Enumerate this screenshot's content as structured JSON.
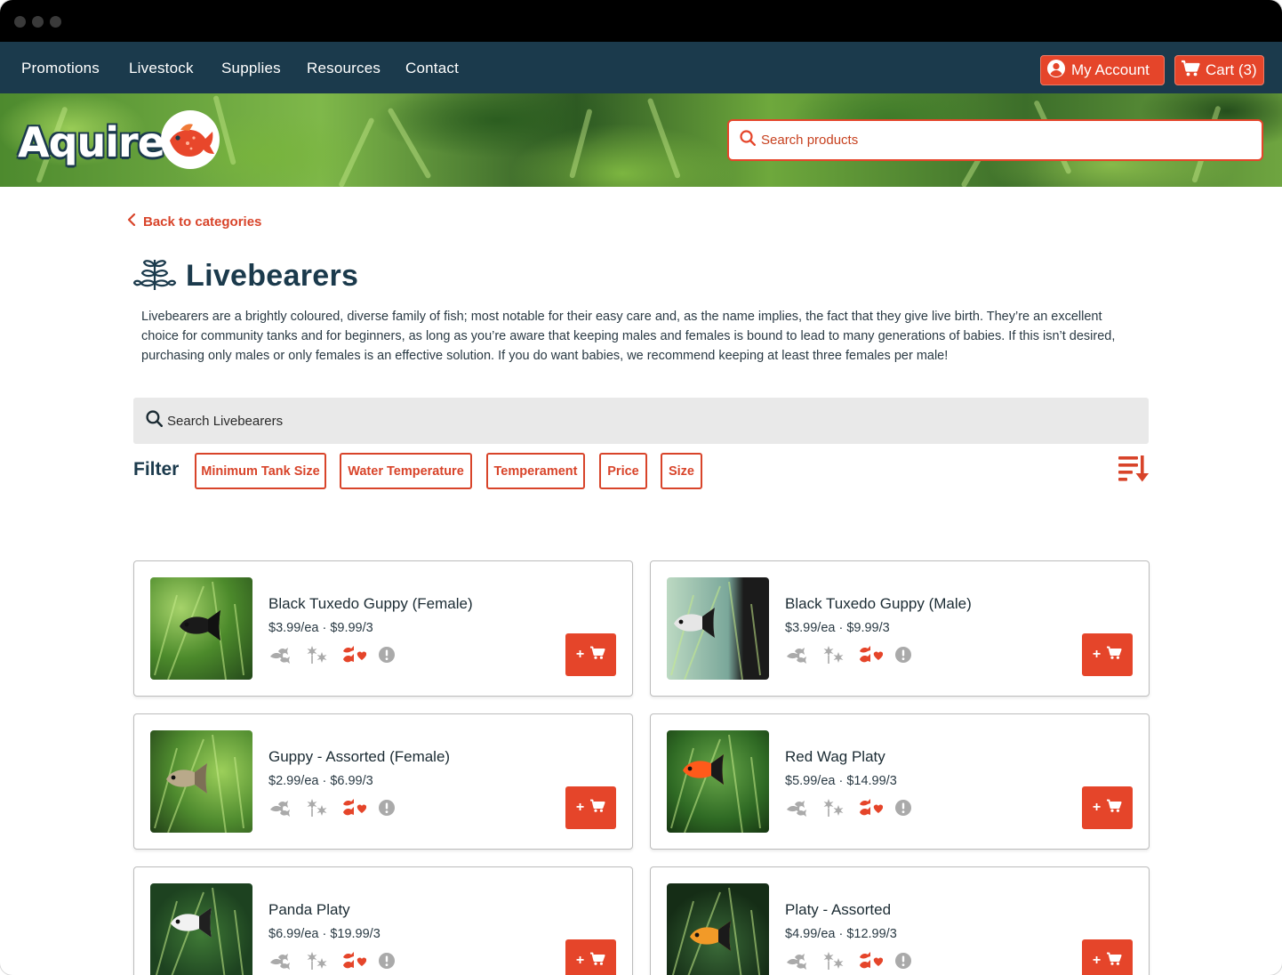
{
  "nav": {
    "links": [
      "Promotions",
      "Livestock",
      "Supplies",
      "Resources",
      "Contact"
    ],
    "account_label": "My Account",
    "cart_label": "Cart (3)"
  },
  "brand": {
    "name": "Aquire"
  },
  "top_search": {
    "placeholder": "Search products"
  },
  "back_link": "Back to categories",
  "category": {
    "title": "Livebearers",
    "description": "Livebearers are a brightly coloured, diverse family of fish; most notable for their easy care and, as the name implies, the fact that they give live birth. They’re an excellent choice for community tanks and for beginners, as long as you’re aware that keeping males and females is bound to lead to many generations of babies. If this isn’t desired, purchasing only males or only females is an effective solution. If you do want babies, we recommend keeping at least three females per male!"
  },
  "category_search": {
    "placeholder": "Search Livebearers"
  },
  "filter": {
    "label": "Filter",
    "options": [
      "Minimum Tank Size",
      "Water Temperature",
      "Temperament",
      "Price",
      "Size"
    ]
  },
  "products": [
    {
      "name": "Black Tuxedo Guppy (Female)",
      "price": "$3.99/ea · $9.99/3"
    },
    {
      "name": "Black Tuxedo Guppy (Male)",
      "price": "$3.99/ea · $9.99/3"
    },
    {
      "name": "Guppy - Assorted (Female)",
      "price": "$2.99/ea · $6.99/3"
    },
    {
      "name": "Red Wag Platy",
      "price": "$5.99/ea · $14.99/3"
    },
    {
      "name": "Panda Platy",
      "price": "$6.99/ea · $19.99/3"
    },
    {
      "name": "Platy - Assorted",
      "price": "$4.99/ea · $12.99/3"
    }
  ],
  "add_to_cart_label": "+",
  "icons": {
    "account": "user-circle-icon",
    "cart": "shopping-cart-icon",
    "search": "search-icon",
    "back": "chevron-left-icon",
    "category": "plant-icon",
    "sort": "sort-descending-icon",
    "attributes": [
      "school-of-fish-icon",
      "plant-icon",
      "fish-heart-icon",
      "info-icon"
    ]
  },
  "colors": {
    "accent": "#e5452a",
    "navbar": "#1b3a4c",
    "heading": "#1b3a4c",
    "muted_icon": "#aaaaaa"
  }
}
